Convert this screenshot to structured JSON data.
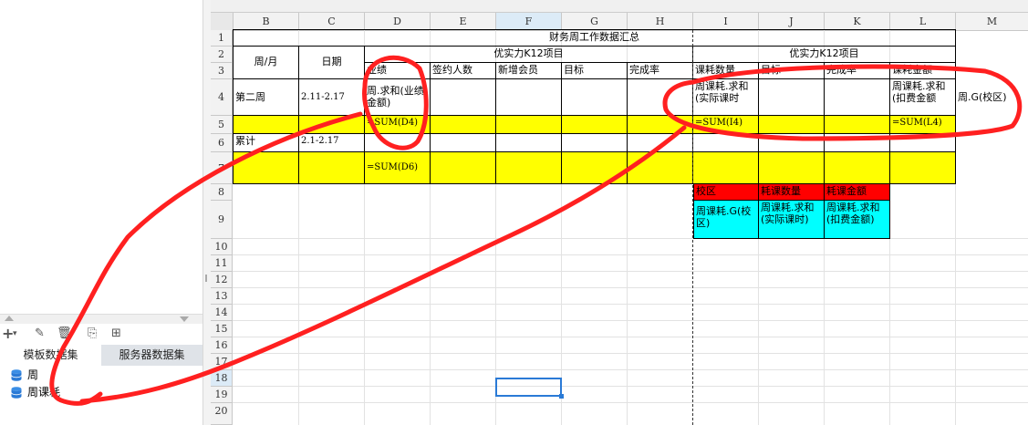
{
  "left_panel": {
    "tabs": [
      "模板数据集",
      "服务器数据集"
    ],
    "datasets": [
      "周",
      "周课耗"
    ]
  },
  "sheet": {
    "columns": [
      "B",
      "C",
      "D",
      "E",
      "F",
      "G",
      "H",
      "I",
      "J",
      "K",
      "L",
      "M"
    ],
    "rows": [
      "1",
      "2",
      "3",
      "4",
      "5",
      "6",
      "7",
      "8",
      "9",
      "10",
      "11",
      "12",
      "13",
      "14",
      "15",
      "16",
      "17",
      "18",
      "19",
      "20"
    ],
    "selected_column": "F",
    "selected_row": "18",
    "title": "财务周工作数据汇总",
    "group_left": "优实力K12项目",
    "group_right": "优实力K12项目",
    "hdr_week": "周/月",
    "hdr_date": "日期",
    "hdr_sales": "业绩",
    "hdr_signed": "签约人数",
    "hdr_newmember": "新增会员",
    "hdr_target": "目标",
    "hdr_rate": "完成率",
    "hdr_lessons": "课耗数量",
    "hdr_target2": "目标",
    "hdr_rate2": "完成率",
    "hdr_amount": "课耗金额",
    "r4_week": "第二周",
    "r4_date": "2.11-2.17",
    "r4_sales": "周.求和(业绩金额)",
    "r4_lessons": "周课耗.求和(实际课时",
    "r4_amount": "周课耗.求和(扣费金额",
    "r4_campus": "周.G(校区)",
    "r5_sum_d": "=SUM(D4)",
    "r5_sum_i": "=SUM(I4)",
    "r5_sum_l": "=SUM(L4)",
    "r6_week": "累计",
    "r6_date": "2.1-2.17",
    "r7_sum_d": "=SUM(D6)",
    "r8_campus": "校区",
    "r8_count": "耗课数量",
    "r8_amount": "耗课金额",
    "r9_campus": "周课耗.G(校区)",
    "r9_count": "周课耗.求和(实际课时)",
    "r9_amount": "周课耗.求和(扣费金额)"
  },
  "colors": {
    "highlight_yellow": "#ffff00",
    "header_red": "#ff0000",
    "data_cyan": "#00ffff",
    "annotation_red": "#ff2020",
    "selection_blue": "#2a7ad6"
  }
}
